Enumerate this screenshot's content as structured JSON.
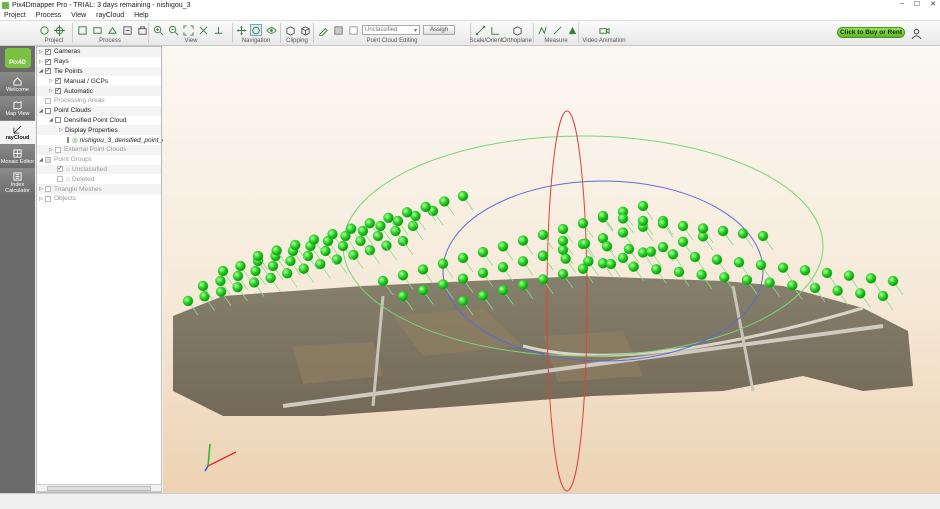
{
  "window": {
    "title": "Pix4Dmapper Pro - TRIAL: 3 days remaining - nishigou_3",
    "minimize": "–",
    "maximize": "☐",
    "close": "✕"
  },
  "menu": [
    "Project",
    "Process",
    "View",
    "rayCloud",
    "Help"
  ],
  "toolbar": {
    "groups": {
      "project": "Project",
      "process": "Process",
      "view": "View",
      "navigation": "Navigation",
      "clipping": "Clipping",
      "pce": "Point Cloud Editing",
      "scale": "Scale/Orient",
      "ortho": "Orthoplane",
      "measure": "Measure",
      "video": "Video Animation"
    },
    "class_select": "Unclassified",
    "assign": "Assign",
    "buy": "Click to Buy or Rent"
  },
  "sidebar": {
    "logo": "Pix4D",
    "items": [
      "Welcome",
      "Map View",
      "rayCloud",
      "Mosaic Editor",
      "Index Calculator"
    ]
  },
  "layers": {
    "rows": [
      {
        "label": "Cameras"
      },
      {
        "label": "Rays"
      },
      {
        "label": "Tie Points"
      },
      {
        "label": "Manual / GCPs"
      },
      {
        "label": "Automatic"
      },
      {
        "label": "Processing Areas"
      },
      {
        "label": "Point Clouds"
      },
      {
        "label": "Densified Point Cloud"
      },
      {
        "label": "Display Properties"
      },
      {
        "label": "nishigou_3_densified_point_cloud"
      },
      {
        "label": "External Point Clouds"
      },
      {
        "label": "Point Groups"
      },
      {
        "label": "Unclassified"
      },
      {
        "label": "Deleted"
      },
      {
        "label": "Triangle Meshes"
      },
      {
        "label": "Objects"
      }
    ]
  },
  "colors": {
    "accent": "#7cc242",
    "camera": "#22c322",
    "sidebar": "#6b6b6b"
  }
}
